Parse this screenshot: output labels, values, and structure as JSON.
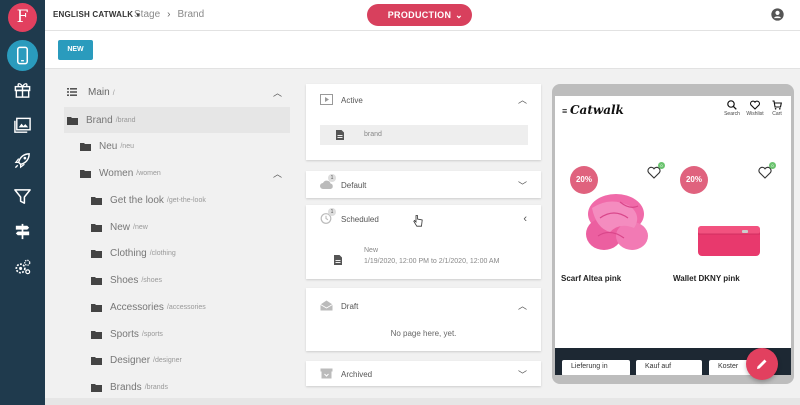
{
  "app": {
    "logo_letter": "F",
    "accent": "#e2405f",
    "nav_active_color": "#2a9bbd",
    "rail_color": "#1f3a4d"
  },
  "rail": {
    "items": [
      {
        "name": "device-mobile-icon",
        "active": true
      },
      {
        "name": "gift-icon",
        "active": false
      },
      {
        "name": "image-gallery-icon",
        "active": false
      },
      {
        "name": "rocket-icon",
        "active": false
      },
      {
        "name": "filter-icon",
        "active": false
      },
      {
        "name": "signpost-icon",
        "active": false
      },
      {
        "name": "settings-icon",
        "active": false
      }
    ]
  },
  "topbar": {
    "language": "ENGLISH CATWALK",
    "breadcrumb": [
      "Stage",
      "Brand"
    ],
    "environment": "PRODUCTION"
  },
  "toolbar": {
    "new_label": "NEW"
  },
  "tree": {
    "root": {
      "label": "Main",
      "path": "/"
    },
    "nodes": [
      {
        "label": "Brand",
        "path": "/brand",
        "level": 0,
        "selected": true
      },
      {
        "label": "Neu",
        "path": "/neu",
        "level": 0
      },
      {
        "label": "Women",
        "path": "/women",
        "level": 0,
        "expanded": true
      },
      {
        "label": "Get the look",
        "path": "/get-the-look",
        "level": 1
      },
      {
        "label": "New",
        "path": "/new",
        "level": 1
      },
      {
        "label": "Clothing",
        "path": "/clothing",
        "level": 1
      },
      {
        "label": "Shoes",
        "path": "/shoes",
        "level": 1
      },
      {
        "label": "Accessories",
        "path": "/accessories",
        "level": 1
      },
      {
        "label": "Sports",
        "path": "/sports",
        "level": 1
      },
      {
        "label": "Designer",
        "path": "/designer",
        "level": 1
      },
      {
        "label": "Brands",
        "path": "/brands",
        "level": 1
      }
    ]
  },
  "panels": {
    "active": {
      "title": "Active",
      "row": "brand"
    },
    "default": {
      "title": "Default",
      "badge": "1"
    },
    "scheduled": {
      "title": "Scheduled",
      "badge": "1",
      "item_title": "New",
      "item_range": "1/19/2020, 12:00 PM to 2/1/2020, 12:00 AM"
    },
    "draft": {
      "title": "Draft",
      "empty": "No page here, yet."
    },
    "archived": {
      "title": "Archived"
    }
  },
  "preview": {
    "brand": "Catwalk",
    "header_items": [
      "Search",
      "Wishlist",
      "Cart"
    ],
    "wish_count": "0",
    "products": [
      {
        "name": "Scarf Altea pink",
        "sale": "20%"
      },
      {
        "name": "Wallet DKNY pink",
        "sale": "20%"
      }
    ],
    "footer_buttons": [
      "Lieferung in",
      "Kauf auf",
      "Koster"
    ]
  }
}
